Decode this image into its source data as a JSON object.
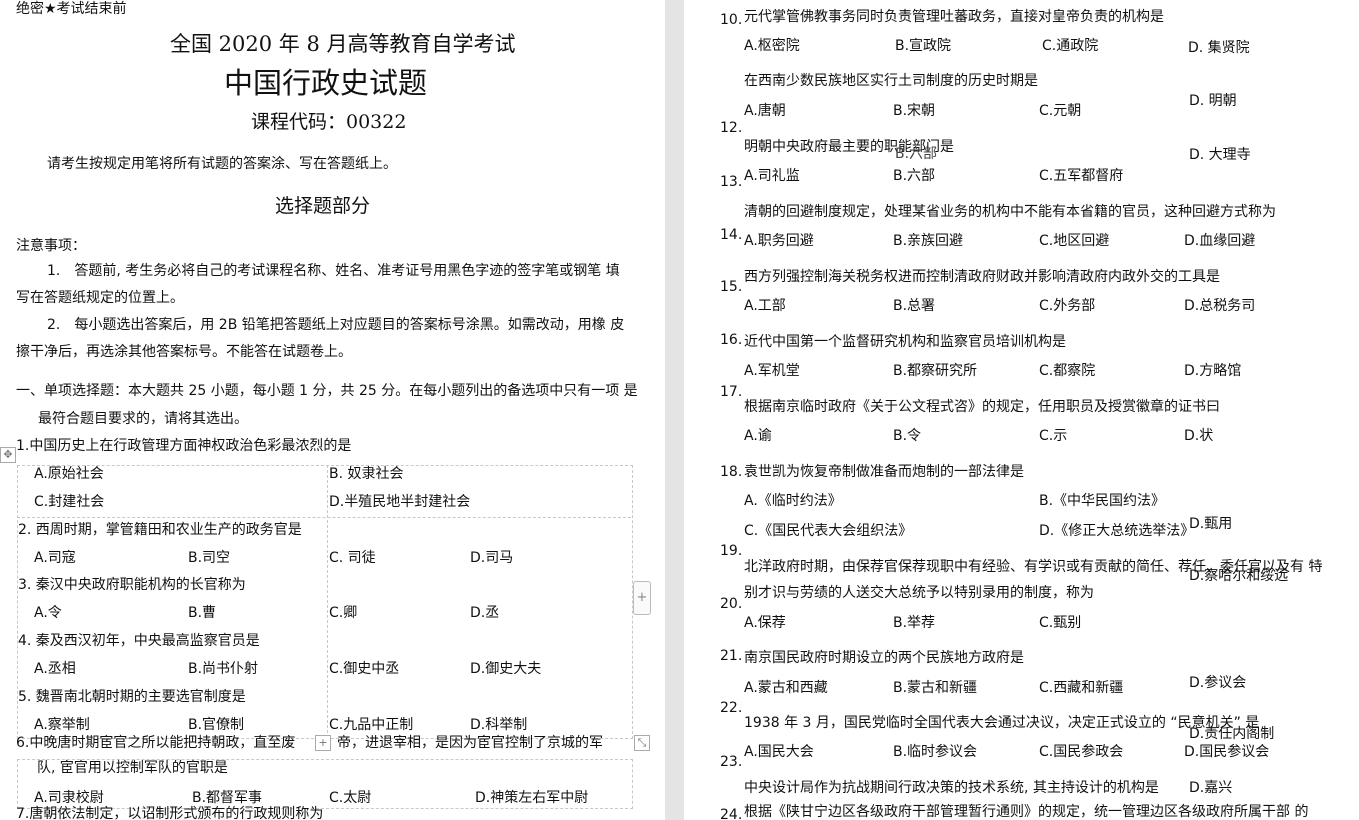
{
  "left": {
    "secret": "绝密★考试结束前",
    "exam_title": "全国 2020 年 8 月高等教育自学考试",
    "paper_title": "中国行政史试题",
    "course_code": "课程代码：00322",
    "instruction": "请考生按规定用笔将所有试题的答案涂、写在答题纸上。",
    "section": "选择题部分",
    "notes_heading": "注意事项：",
    "note1_a": "1.　答题前, 考生务必将自己的考试课程名称、姓名、准考证号用黑色字迹的签字笔或钢笔 填",
    "note1_b": "写在答题纸规定的位置上。",
    "note2_a": "2.　每小题选出答案后，用 2B 铅笔把答题纸上对应题目的答案标号涂黑。如需改动，用橡 皮",
    "note2_b": "擦干净后，再选涂其他答案标号。不能答在试题卷上。",
    "part1_a": "一、单项选择题：本大题共 25 小题，每小题 1 分，共 25 分。在每小题列出的备选项中只有一项 是",
    "part1_b": "最符合题目要求的，请将其选出。",
    "q1": "1.中国历史上在行政管理方面神权政治色彩最浓烈的是",
    "q1_a": "A.原始社会",
    "q1_b": "B. 奴隶社会",
    "q1_c": "C.封建社会",
    "q1_d": "D.半殖民地半封建社会",
    "q2": "2. 西周时期，掌管籍田和农业生产的政务官是",
    "q2_a": "A.司寇",
    "q2_b": "B.司空",
    "q2_c": "C. 司徒",
    "q2_d": "D.司马",
    "q3": "3. 秦汉中央政府职能机构的长官称为",
    "q3_a": "A.令",
    "q3_b": "B.曹",
    "q3_c": "C.卿",
    "q3_d": "D.丞",
    "q4": "4. 秦及西汉初年，中央最高监察官员是",
    "q4_a": "A.丞相",
    "q4_b": "B.尚书仆射",
    "q4_c": "C.御史中丞",
    "q4_d": "D.御史大夫",
    "q5": "5. 魏晋南北朝时期的主要选官制度是",
    "q5_a": "A.察举制",
    "q5_b": "B.官僚制",
    "q5_c": "C.九品中正制",
    "q5_d": "D.科举制",
    "q6_a": "6.中晚唐时期宦官之所以能把持朝政，直至废",
    "q6_a2": "帝，进退宰相，是因为宦官控制了京城的军",
    "q6_b": "队, 宦官用以控制军队的官职是",
    "q6_opt_a": "A.司隶校尉",
    "q6_opt_b": "B.都督军事",
    "q6_opt_c": "C.太尉",
    "q6_opt_d": "D.神策左右军中尉",
    "q7": "7.唐朝依法制定，以诏制形式颁布的行政规则称为"
  },
  "right": {
    "n10": "10.",
    "q10": "元代掌管佛教事务同时负责管理吐蕃政务，直接对皇帝负责的机构是",
    "q10_a": "A.枢密院",
    "q10_b": "B.宣政院",
    "q10_c": "C.通政院",
    "q10_d": "D. 集贤院",
    "q11": "在西南少数民族地区实行土司制度的历史时期是",
    "q11_a": "A.唐朝",
    "q11_b": "B.宋朝",
    "q11_c": "C.元朝",
    "q11_d": "D. 明朝",
    "n12": "12.",
    "q12": "明朝中央政府最主要的职能部门是",
    "q12_ghost": "B.六部",
    "q12_d_ghost": "D. 大理寺",
    "n13": "13.",
    "q12_a": "A.司礼监",
    "q12_b": "B.六部",
    "q12_c": "C.五军都督府",
    "q13": "清朝的回避制度规定，处理某省业务的机构中不能有本省籍的官员，这种回避方式称为",
    "n14": "14.",
    "q13_a": "A.职务回避",
    "q13_b": "B.亲族回避",
    "q13_c": "C.地区回避",
    "q13_d": "D.血缘回避",
    "q14": "西方列强控制海关税务权进而控制清政府财政并影响清政府内政外交的工具是",
    "n15": "15.",
    "q14_a": "A.工部",
    "q14_b": "B.总署",
    "q14_c": "C.外务部",
    "q14_d": "D.总税务司",
    "n16": "16.",
    "q15": "近代中国第一个监督研究机构和监察官员培训机构是",
    "q15_a": "A.军机堂",
    "q15_b": "B.都察研究所",
    "q15_c": "C.都察院",
    "q15_d": "D.方略馆",
    "n17": "17.",
    "q16": "根据南京临时政府《关于公文程式咨》的规定，任用职员及授赏徽章的证书曰",
    "q16_a": "A.谕",
    "q16_b": "B.令",
    "q16_c": "C.示",
    "q16_d": "D.状",
    "n18": "18.",
    "q17": "袁世凯为恢复帝制做准备而炮制的一部法律是",
    "q17_a": "A.《临时约法》",
    "q17_b": "B.《中华民国约法》",
    "q17_c": "C.《国民代表大会组织法》",
    "q17_d": "D.《修正大总统选举法》",
    "q17_ghost": "D.甄用",
    "n19": "19.",
    "q18_a": "北洋政府时期，由保荐官保荐现职中有经验、有学识或有贡献的简任、荐任、委任官以及有 特",
    "q18_ghost": "D.察哈尔和绥远",
    "q18_b": "别才识与劳绩的人送交大总统予以特别录用的制度，称为",
    "n20": "20.",
    "q18_opt_a": "A.保荐",
    "q18_opt_b": "B.举荐",
    "q18_opt_c": "C.甄别",
    "n21": "21.",
    "q19": "南京国民政府时期设立的两个民族地方政府是",
    "q19_a": "A.蒙古和西藏",
    "q19_b": "B.蒙古和新疆",
    "q19_c": "C.西藏和新疆",
    "q19_d_ghost": "D.参议会",
    "n22": "22.",
    "q20": "1938 年 3 月，国民党临时全国代表大会通过决议，决定正式设立的 “民意机关” 是",
    "q20_ghost": "D.责任内阁制",
    "n23": "23.",
    "q20_a": "A.国民大会",
    "q20_b": "B.临时参议会",
    "q20_c": "C.国民参政会",
    "q20_d": "D.国民参议会",
    "q21": "中央设计局作为抗战期间行政决策的技术系统, 其主持设计的机构是",
    "q21_ghost": "D.嘉兴",
    "n24": "24.",
    "q22": "根据《陕甘宁边区各级政府干部管理暂行通则》的规定，统一管理边区各级政府所属干部 的"
  }
}
